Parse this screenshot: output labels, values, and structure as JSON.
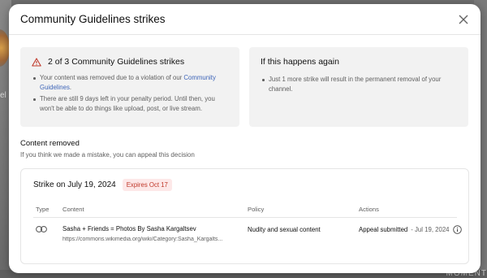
{
  "background": {
    "left_text": "el",
    "right_text": "MOMENT"
  },
  "dialog": {
    "title": "Community Guidelines strikes",
    "close_icon": "close-icon"
  },
  "strikes_card": {
    "heading": "2 of 3 Community Guidelines strikes",
    "warning_icon": "warning-triangle-icon",
    "bullet1_prefix": "Your content was removed due to a violation of our ",
    "bullet1_link": "Community Guidelines",
    "bullet1_suffix": ".",
    "bullet2": "There are still 9 days left in your penalty period. Until then, you won't be able to do things like upload, post, or live stream."
  },
  "again_card": {
    "heading": "If this happens again",
    "bullet1": "Just 1 more strike will result in the permanent removal of your channel."
  },
  "content_removed": {
    "title": "Content removed",
    "subtitle": "If you think we made a mistake, you can appeal this decision"
  },
  "strike": {
    "date_label": "Strike on July 19, 2024",
    "expires_badge": "Expires Oct 17",
    "columns": [
      "Type",
      "Content",
      "Policy",
      "Actions"
    ],
    "row": {
      "type_icon": "link-icon",
      "content_title": "Sasha + Friends = Photos By Sasha Kargaltsev",
      "content_url": "https://commons.wikimedia.org/wiki/Category:Sasha_Kargalts...",
      "policy": "Nudity and sexual content",
      "action_status": "Appeal submitted",
      "action_date": "- Jul 19, 2024",
      "info_icon": "info-icon"
    }
  },
  "colors": {
    "link": "#3e65b8",
    "badge_text": "#c0392b",
    "badge_bg": "#fde8e8",
    "card_bg": "#f2f2f2"
  }
}
